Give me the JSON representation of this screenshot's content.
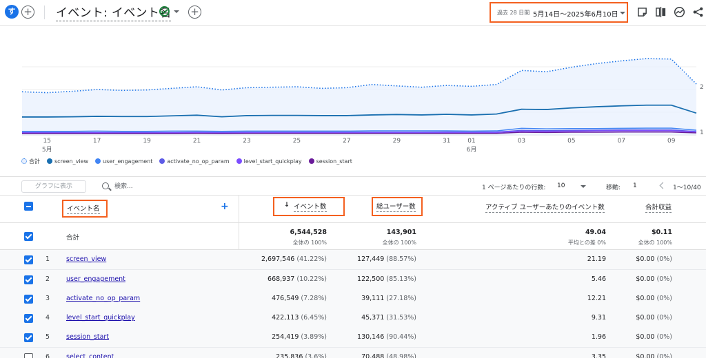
{
  "header": {
    "avatar_letter": "す",
    "title": "イベント: イベント名",
    "date_prefix": "過去 28 日間",
    "date_range": "5月14日～2025年6月10日"
  },
  "icons": {
    "add": "plus-circle-icon",
    "status": "check-circle-icon",
    "share_report": "share-icon",
    "insights": "insights-icon",
    "compare": "compare-icon",
    "customize": "edit-report-icon"
  },
  "colors": {
    "accent": "#1a73e8",
    "highlight_box": "#f4601f",
    "total_fill": "#e8f0fe",
    "screen_view": "#1a6fb0",
    "user_engagement": "#4285f4",
    "activate_no_op_param": "#5e5ce6",
    "level_start_quickplay": "#7c4dff",
    "session_start": "#6a1b9a"
  },
  "chart_data": {
    "type": "line",
    "x": [
      "05-14",
      "05-15",
      "05-16",
      "05-17",
      "05-18",
      "05-19",
      "05-20",
      "05-21",
      "05-22",
      "05-23",
      "05-24",
      "05-25",
      "05-26",
      "05-27",
      "05-28",
      "05-29",
      "05-30",
      "05-31",
      "06-01",
      "06-02",
      "06-03",
      "06-04",
      "06-05",
      "06-06",
      "06-07",
      "06-08",
      "06-09",
      "06-10"
    ],
    "x_tick_labels": [
      "15",
      "17",
      "19",
      "21",
      "23",
      "25",
      "27",
      "29",
      "31",
      "01",
      "03",
      "05",
      "07",
      "09"
    ],
    "x_month_labels": [
      "5月",
      "6月"
    ],
    "y_tick_labels": [
      "1",
      "2"
    ],
    "series": [
      {
        "name": "合計",
        "values": [
          190,
          186,
          192,
          200,
          196,
          198,
          205,
          212,
          198,
          208,
          210,
          212,
          205,
          208,
          222,
          216,
          210,
          218,
          214,
          222,
          284,
          278,
          298,
          314,
          326,
          336,
          334,
          224
        ]
      },
      {
        "name": "screen_view",
        "values": [
          79,
          79,
          80,
          82,
          81,
          81,
          84,
          87,
          80,
          85,
          86,
          86,
          85,
          85,
          88,
          90,
          88,
          91,
          88,
          92,
          113,
          112,
          119,
          124,
          128,
          131,
          131,
          96
        ]
      },
      {
        "name": "user_engagement",
        "values": [
          16,
          16,
          16,
          17,
          16,
          16,
          17,
          17,
          16,
          17,
          17,
          17,
          17,
          17,
          18,
          18,
          18,
          18,
          17,
          18,
          29,
          27,
          28,
          28,
          29,
          30,
          30,
          21
        ]
      },
      {
        "name": "activate_no_op_param",
        "values": [
          11,
          11,
          11,
          11,
          11,
          11,
          11,
          12,
          11,
          12,
          12,
          12,
          12,
          12,
          12,
          12,
          12,
          13,
          12,
          13,
          20,
          19,
          20,
          21,
          22,
          22,
          22,
          15
        ]
      },
      {
        "name": "level_start_quickplay",
        "values": [
          9,
          9,
          9,
          10,
          9,
          9,
          10,
          10,
          9,
          10,
          10,
          10,
          10,
          10,
          10,
          11,
          10,
          11,
          10,
          11,
          17,
          16,
          17,
          18,
          19,
          19,
          19,
          13
        ]
      },
      {
        "name": "session_start",
        "values": [
          6,
          6,
          6,
          6,
          6,
          6,
          6,
          7,
          6,
          7,
          7,
          7,
          7,
          7,
          7,
          7,
          7,
          7,
          7,
          7,
          12,
          11,
          12,
          12,
          13,
          13,
          13,
          9
        ]
      }
    ],
    "grid": true,
    "legend_position": "bottom-left"
  },
  "legend": [
    {
      "label": "合計",
      "color": "#e8f0fe",
      "hollow": true
    },
    {
      "label": "screen_view",
      "color": "#1a6fb0"
    },
    {
      "label": "user_engagement",
      "color": "#4285f4"
    },
    {
      "label": "activate_no_op_param",
      "color": "#5e5ce6"
    },
    {
      "label": "level_start_quickplay",
      "color": "#7c4dff"
    },
    {
      "label": "session_start",
      "color": "#6a1b9a"
    }
  ],
  "toolbar": {
    "graph_button": "グラフに表示",
    "search_placeholder": "検索...",
    "rows_label": "1 ページあたりの行数:",
    "rows_value": "10",
    "goto_label": "移動:",
    "goto_value": "1",
    "pager": "1～10/40"
  },
  "table": {
    "headers": {
      "event_name": "イベント名",
      "event_count": "イベント数",
      "sort_arrow": "↓",
      "total_users": "総ユーザー数",
      "events_per_user": "アクティブ ユーザーあたりのイベント数",
      "revenue": "合計収益"
    },
    "total": {
      "label": "合計",
      "event_count": "6,544,528",
      "event_count_sub": "全体の 100%",
      "total_users": "143,901",
      "total_users_sub": "全体の 100%",
      "events_per_user": "49.04",
      "events_per_user_sub": "平均との差 0%",
      "revenue": "$0.11",
      "revenue_sub": "全体の 100%"
    },
    "rows": [
      {
        "rank": "1",
        "name": "screen_view",
        "events": "2,697,546",
        "events_pct": "(41.22%)",
        "users": "127,449",
        "users_pct": "(88.57%)",
        "per_user": "21.19",
        "revenue": "$0.00",
        "revenue_pct": "(0%)",
        "checked": true
      },
      {
        "rank": "2",
        "name": "user_engagement",
        "events": "668,937",
        "events_pct": "(10.22%)",
        "users": "122,500",
        "users_pct": "(85.13%)",
        "per_user": "5.46",
        "revenue": "$0.00",
        "revenue_pct": "(0%)",
        "checked": true
      },
      {
        "rank": "3",
        "name": "activate_no_op_param",
        "events": "476,549",
        "events_pct": "(7.28%)",
        "users": "39,111",
        "users_pct": "(27.18%)",
        "per_user": "12.21",
        "revenue": "$0.00",
        "revenue_pct": "(0%)",
        "checked": true
      },
      {
        "rank": "4",
        "name": "level_start_quickplay",
        "events": "422,113",
        "events_pct": "(6.45%)",
        "users": "45,371",
        "users_pct": "(31.53%)",
        "per_user": "9.31",
        "revenue": "$0.00",
        "revenue_pct": "(0%)",
        "checked": true
      },
      {
        "rank": "5",
        "name": "session_start",
        "events": "254,419",
        "events_pct": "(3.89%)",
        "users": "130,146",
        "users_pct": "(90.44%)",
        "per_user": "1.96",
        "revenue": "$0.00",
        "revenue_pct": "(0%)",
        "checked": true
      },
      {
        "rank": "6",
        "name": "select_content",
        "events": "235,836",
        "events_pct": "(3.6%)",
        "users": "70,488",
        "users_pct": "(48.98%)",
        "per_user": "3.35",
        "revenue": "$0.00",
        "revenue_pct": "(0%)",
        "checked": false
      }
    ]
  }
}
